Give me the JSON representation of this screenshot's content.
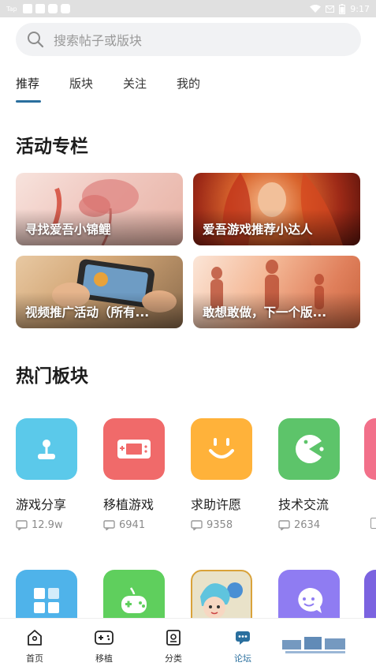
{
  "statusbar": {
    "left_text": "Tap",
    "time": "9:17"
  },
  "search": {
    "placeholder": "搜索帖子或版块"
  },
  "tabs": [
    {
      "label": "推荐",
      "active": true
    },
    {
      "label": "版块",
      "active": false
    },
    {
      "label": "关注",
      "active": false
    },
    {
      "label": "我的",
      "active": false
    }
  ],
  "activity": {
    "title": "活动专栏",
    "cards": [
      {
        "label": "寻找爱吾小锦鲤"
      },
      {
        "label": "爱吾游戏推荐小达人"
      },
      {
        "label": "视频推广活动（所有..."
      },
      {
        "label": "敢想敢做，下一个版..."
      }
    ]
  },
  "hot": {
    "title": "热门板块",
    "boards": [
      {
        "name": "游戏分享",
        "count": "12.9w",
        "color": "#5bc9ea",
        "icon": "joystick-icon"
      },
      {
        "name": "移植游戏",
        "count": "6941",
        "color": "#f06a6a",
        "icon": "handheld-console-icon"
      },
      {
        "name": "求助许愿",
        "count": "9358",
        "color": "#ffb23a",
        "icon": "smile-face-icon"
      },
      {
        "name": "技术交流",
        "count": "2634",
        "color": "#5dc46a",
        "icon": "pacman-icon"
      }
    ],
    "boards_row2_icons": [
      "grid-tiles-icon",
      "gamepad-icon",
      "cartoon-character-icon",
      "chat-bubble-icon"
    ]
  },
  "bottom_nav": [
    {
      "label": "首页",
      "icon": "home-icon"
    },
    {
      "label": "移植",
      "icon": "gamepad-icon"
    },
    {
      "label": "分类",
      "icon": "category-icon"
    },
    {
      "label": "论坛",
      "icon": "forum-icon",
      "active": true
    }
  ],
  "colors": {
    "accent": "#2a6f9e"
  }
}
